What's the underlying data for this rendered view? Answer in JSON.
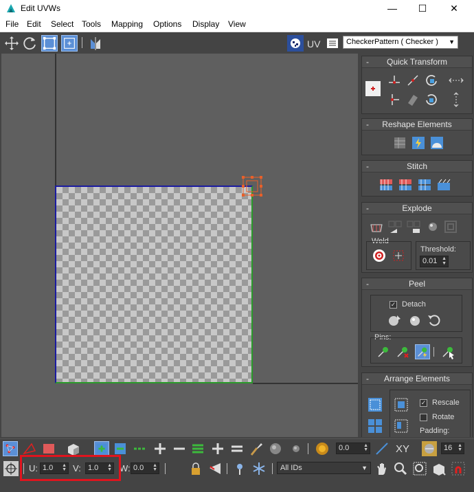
{
  "window": {
    "title": "Edit UVWs",
    "controls": {
      "minimize": "—",
      "maximize": "☐",
      "close": "✕"
    }
  },
  "menu": [
    "File",
    "Edit",
    "Select",
    "Tools",
    "Mapping",
    "Options",
    "Display",
    "View"
  ],
  "toolbar": {
    "uv_label": "UV",
    "texture_dropdown": "CheckerPattern  ( Checker )"
  },
  "panel": {
    "quick_transform": {
      "title": "Quick Transform",
      "toggle": "-"
    },
    "reshape": {
      "title": "Reshape Elements",
      "toggle": "-"
    },
    "stitch": {
      "title": "Stitch",
      "toggle": "-"
    },
    "explode": {
      "title": "Explode",
      "toggle": "-",
      "weld_label": "Weld",
      "threshold_label": "Threshold:",
      "threshold_value": "0.01"
    },
    "peel": {
      "title": "Peel",
      "toggle": "-",
      "detach_label": "Detach",
      "detach_checked": "✓",
      "pins_label": "Pins:"
    },
    "arrange": {
      "title": "Arrange Elements",
      "toggle": "-",
      "rescale_label": "Rescale",
      "rescale_checked": "✓",
      "rotate_label": "Rotate",
      "padding_label": "Padding:"
    }
  },
  "bottom": {
    "soft_select_value": "0.0",
    "xy_label": "XY",
    "grid_value": "16",
    "u_label": "U:",
    "u_value": "1.0",
    "v_label": "V:",
    "v_value": "1.0",
    "w_label": "W:",
    "w_value": "0.0",
    "id_filter": "All IDs"
  },
  "colors": {
    "highlight": "#e0141e",
    "selection_active": "#5b8fd6",
    "uv_border_top_left": "#1a1aa0",
    "uv_border_bottom_right": "#2a9a2a",
    "gizmo": "#e8602a"
  }
}
